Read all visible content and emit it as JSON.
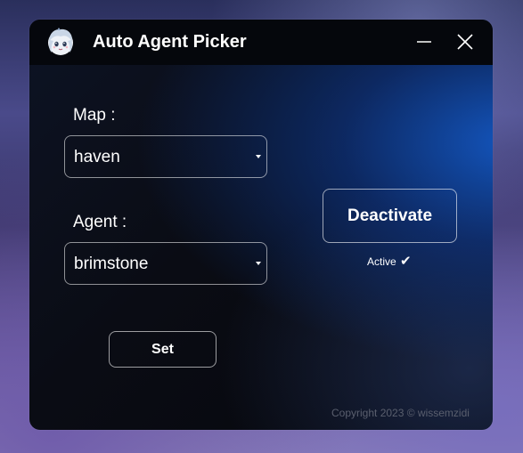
{
  "window": {
    "title": "Auto Agent Picker",
    "app_icon": "anime-avatar-icon",
    "controls": {
      "minimize_icon": "minimize-icon",
      "close_icon": "close-icon"
    }
  },
  "map": {
    "label": "Map :",
    "selected": "haven"
  },
  "agent": {
    "label": "Agent :",
    "selected": "brimstone"
  },
  "actions": {
    "set_label": "Set",
    "deactivate_label": "Deactivate"
  },
  "status": {
    "text": "Active",
    "icon": "check-icon",
    "check_glyph": "✔"
  },
  "footer": {
    "copyright": "Copyright 2023 © wissemzidi"
  },
  "colors": {
    "accent_blue": "#1a5fd0",
    "background": "#06070c",
    "text": "#ffffff",
    "muted_text": "#5a5f6e"
  }
}
